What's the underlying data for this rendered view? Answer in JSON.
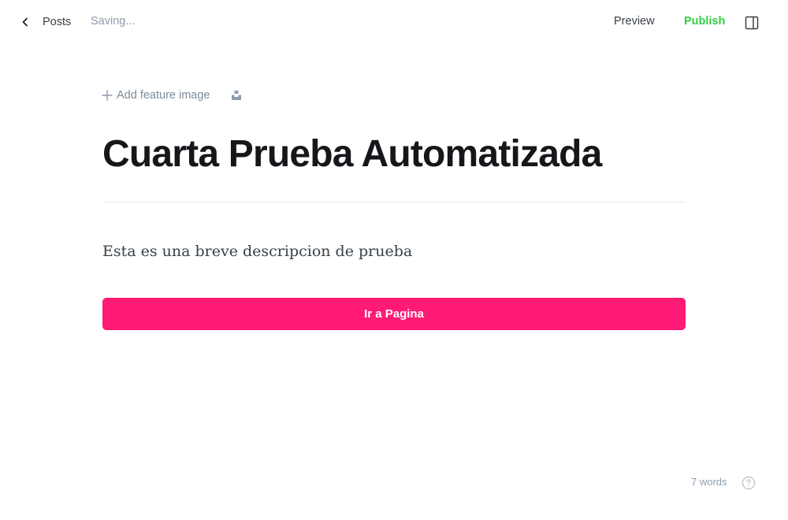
{
  "header": {
    "back_label": "Posts",
    "save_status": "Saving...",
    "preview_label": "Preview",
    "publish_label": "Publish"
  },
  "editor": {
    "add_feature_image_label": "Add feature image",
    "title": "Cuarta Prueba Automatizada",
    "body_text": "Esta es una breve descripcion de prueba",
    "button_label": "Ir a Pagina"
  },
  "footer": {
    "word_count": "7 words"
  },
  "icons": {
    "back": "chevron-left-icon",
    "add": "plus-icon",
    "unsplash": "unsplash-icon",
    "sidebar": "sidebar-panel-icon",
    "help": "question-circle-icon"
  },
  "colors": {
    "publish": "#30cf43",
    "cta_background": "#ff1a75",
    "muted_text": "#8e9cac"
  }
}
